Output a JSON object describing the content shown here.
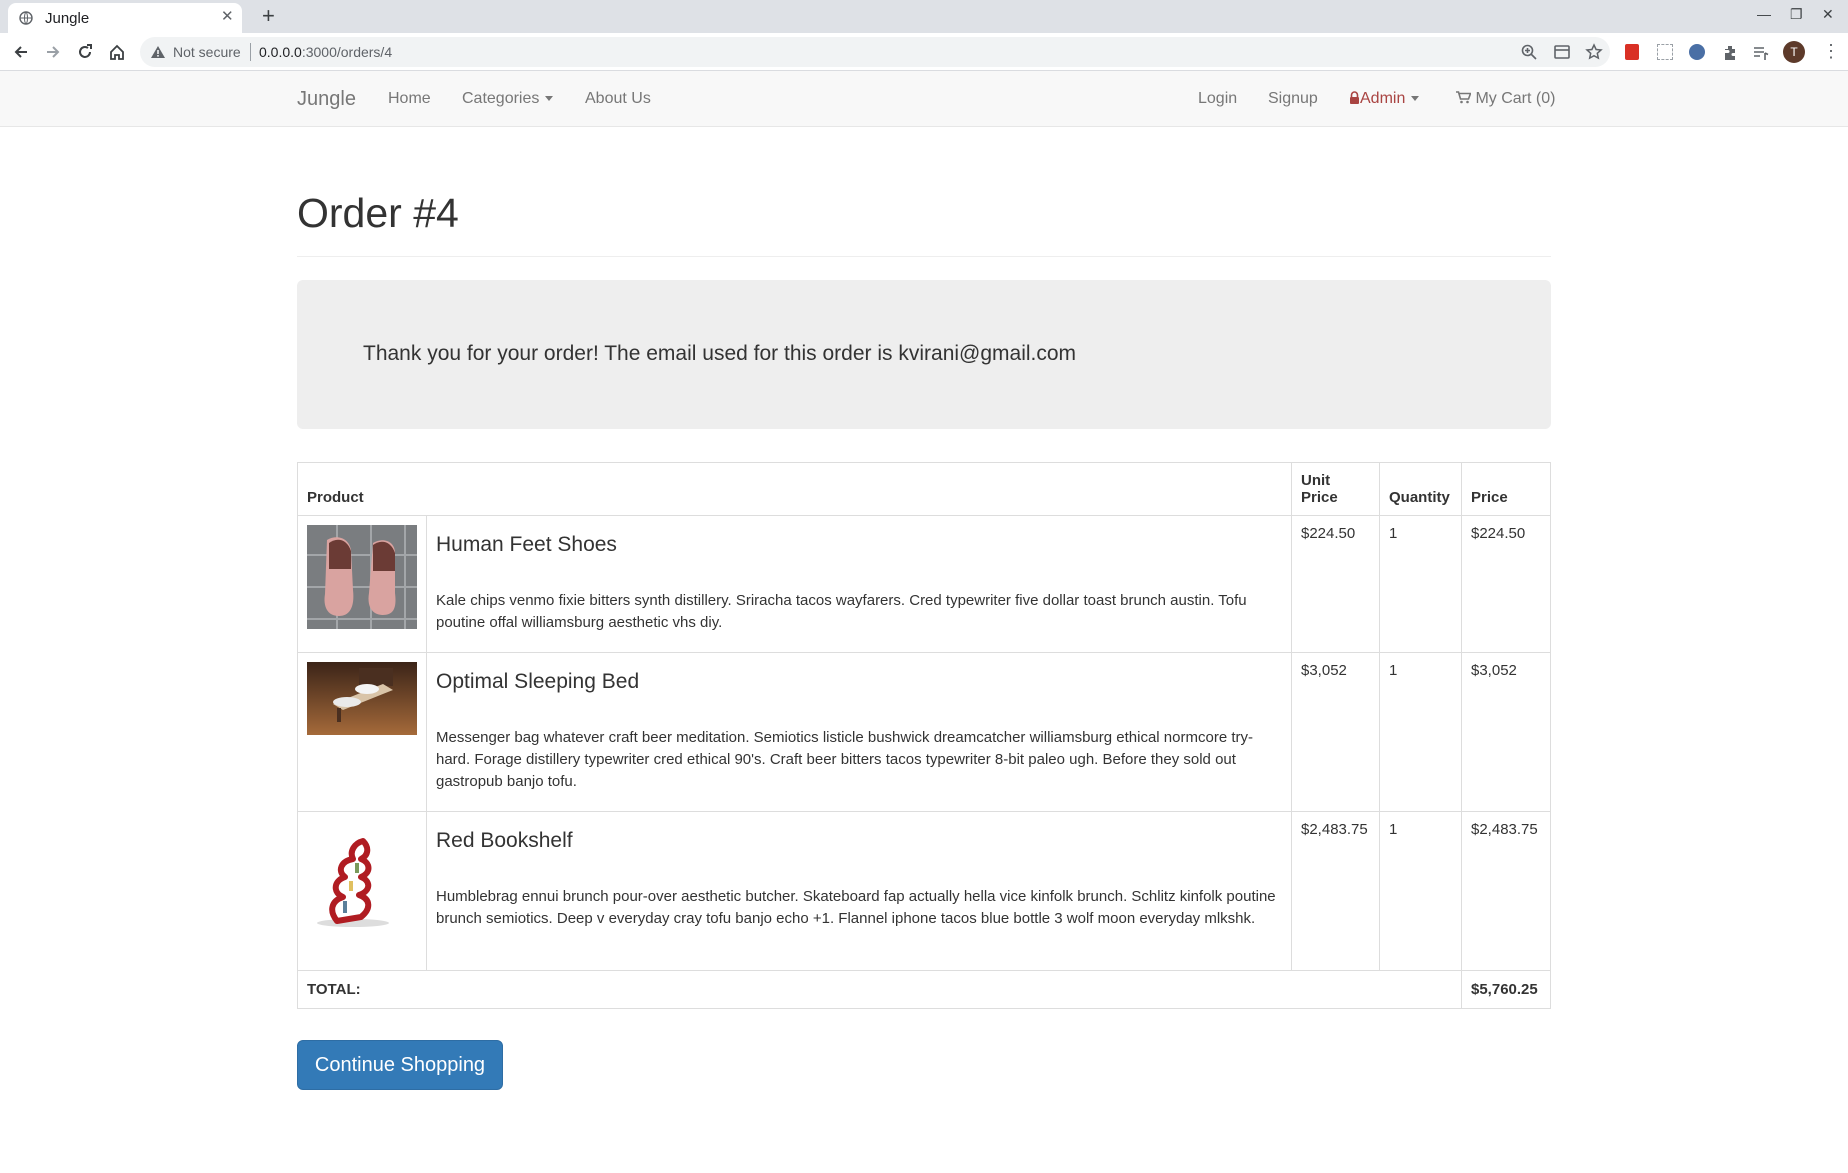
{
  "browser": {
    "tab_title": "Jungle",
    "omnibox_security": "Not secure",
    "url_host": "0.0.0.0",
    "url_rest": ":3000/orders/4",
    "profile_initial": "T",
    "icons": [
      "back-icon",
      "forward-icon",
      "reload-icon",
      "home-icon",
      "zoom-icon",
      "reader-icon",
      "bookmark-star-icon",
      "extensions-icon",
      "reading-list-icon"
    ]
  },
  "navbar": {
    "brand": "Jungle",
    "home": "Home",
    "categories": "Categories",
    "about": "About Us",
    "login": "Login",
    "signup": "Signup",
    "admin": "Admin",
    "cart": "My Cart (0)",
    "admin_color": "#a94442"
  },
  "page": {
    "title": "Order #4",
    "thank_you": "Thank you for your order! The email used for this order is kvirani@gmail.com"
  },
  "table": {
    "headers": {
      "product": "Product",
      "unit_price": "Unit Price",
      "quantity": "Quantity",
      "price": "Price"
    },
    "rows": [
      {
        "name": "Human Feet Shoes",
        "description": "Kale chips venmo fixie bitters synth distillery. Sriracha tacos wayfarers. Cred typewriter five dollar toast brunch austin. Tofu poutine offal williamsburg aesthetic vhs diy.",
        "unit_price": "$224.50",
        "quantity": "1",
        "price": "$224.50"
      },
      {
        "name": "Optimal Sleeping Bed",
        "description": "Messenger bag whatever craft beer meditation. Semiotics listicle bushwick dreamcatcher williamsburg ethical normcore try-hard. Forage distillery typewriter cred ethical 90's. Craft beer bitters tacos typewriter 8-bit paleo ugh. Before they sold out gastropub banjo tofu.",
        "unit_price": "$3,052",
        "quantity": "1",
        "price": "$3,052"
      },
      {
        "name": "Red Bookshelf",
        "description": "Humblebrag ennui brunch pour-over aesthetic butcher. Skateboard fap actually hella vice kinfolk brunch. Schlitz kinfolk poutine brunch semiotics. Deep v everyday cray tofu banjo echo +1. Flannel iphone tacos blue bottle 3 wolf moon everyday mlkshk.",
        "unit_price": "$2,483.75",
        "quantity": "1",
        "price": "$2,483.75"
      }
    ],
    "total_label": "TOTAL:",
    "total_value": "$5,760.25"
  },
  "actions": {
    "continue_shopping": "Continue Shopping",
    "button_color": "#337ab7"
  }
}
